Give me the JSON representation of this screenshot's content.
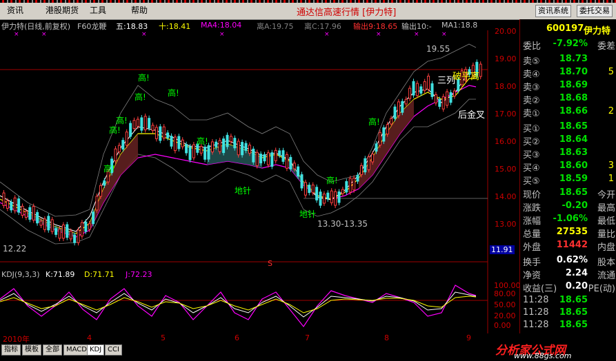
{
  "menu": [
    "资讯",
    "港股期货",
    "工具",
    "帮助"
  ],
  "app_title": "通达信高速行情",
  "stock_bracket": "[伊力特]",
  "toolbar": {
    "news_button": "资讯系统",
    "trade_button": "委托交易"
  },
  "chart_header": {
    "name": "伊力特(日线,前复权)",
    "indicator": "F60龙鞭",
    "five": "五:18.83",
    "ten": "十:18.41",
    "ma4": "MA4:18.04",
    "li_a": "离A:19.75",
    "li_c": "离C:17.96",
    "out9": "输出9:18.65",
    "out10": "输出10:-",
    "ma1": "MA1:18.8"
  },
  "annotations": {
    "high1": "高!",
    "high2": "高!",
    "high3": "高!",
    "high4": "高!",
    "high5": "高!",
    "high6": "高!",
    "high7": "高!",
    "high8": "高!",
    "high9": "高!",
    "dizhen1": "地针",
    "dizhen2": "地针",
    "range": "13.30-13.35",
    "low_mark": "12.22",
    "peak": "19.55",
    "sanlie": "三列",
    "houjincha": "后金叉",
    "pohuxi": "破平离"
  },
  "price_axis": [
    "20.00",
    "19.00",
    "18.00",
    "17.00",
    "16.00",
    "15.00",
    "14.00",
    "13.00",
    "11.91"
  ],
  "kdj_header": {
    "name": "KDJ(9,3,3)",
    "k": "K:71.89",
    "d": "D:71.71",
    "j": "J:72.23"
  },
  "kdj_axis": [
    "100.00",
    "80.00",
    "50.00",
    "20.00",
    "0.00"
  ],
  "dates": [
    "2010年",
    "4",
    "5",
    "6",
    "7",
    "8",
    "9"
  ],
  "tabs": [
    "指标",
    "模板",
    "全部",
    "MACD",
    "KDJ",
    "CCI"
  ],
  "quote": {
    "code": "600197",
    "name": "伊力特",
    "weibi_label": "委比",
    "weibi": "-7.92%",
    "weicha_label": "委差",
    "sell": [
      {
        "label": "卖⑤",
        "price": "18.73",
        "qty": ""
      },
      {
        "label": "卖④",
        "price": "18.70",
        "qty": "5"
      },
      {
        "label": "卖③",
        "price": "18.69",
        "qty": ""
      },
      {
        "label": "卖②",
        "price": "18.68",
        "qty": ""
      },
      {
        "label": "卖①",
        "price": "18.66",
        "qty": "2"
      }
    ],
    "buy": [
      {
        "label": "买①",
        "price": "18.65",
        "qty": ""
      },
      {
        "label": "买②",
        "price": "18.64",
        "qty": ""
      },
      {
        "label": "买③",
        "price": "18.63",
        "qty": ""
      },
      {
        "label": "买④",
        "price": "18.60",
        "qty": "3"
      },
      {
        "label": "买⑤",
        "price": "18.59",
        "qty": "1"
      }
    ],
    "stats": [
      {
        "label": "现价",
        "value": "18.65",
        "k2": "今开"
      },
      {
        "label": "涨跌",
        "value": "-0.20",
        "k2": "最高"
      },
      {
        "label": "涨幅",
        "value": "-1.06%",
        "k2": "最低"
      },
      {
        "label": "总量",
        "value": "27535",
        "k2": "量比"
      },
      {
        "label": "外盘",
        "value": "11442",
        "k2": "内盘"
      }
    ],
    "extra": [
      {
        "label": "换手",
        "value": "0.62%",
        "k2": "股本"
      },
      {
        "label": "净资",
        "value": "2.24",
        "k2": "流通"
      },
      {
        "label": "收益(三)",
        "value": "0.20",
        "k2": "PE(动)"
      }
    ],
    "ticks": [
      {
        "time": "11:28",
        "price": "18.65"
      },
      {
        "time": "11:28",
        "price": "18.65"
      },
      {
        "time": "11:28",
        "price": "18.65"
      }
    ]
  },
  "watermark": {
    "title": "分析家公式网",
    "url": "www.88gs.com"
  }
}
